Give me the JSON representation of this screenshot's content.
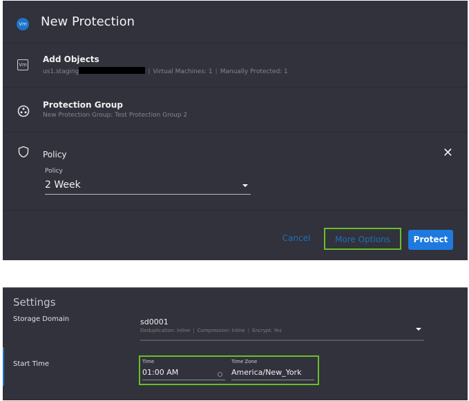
{
  "dialog": {
    "title": "New Protection",
    "title_badge": "Vm",
    "steps": [
      {
        "title": "Add Objects",
        "icon": "vm-icon",
        "icon_text": "Vm",
        "source": "us1.staging",
        "details": [
          "Virtual Machines: 1",
          "Manually Protected: 1"
        ]
      },
      {
        "title": "Protection Group",
        "icon": "protection-group-icon",
        "subtitle": "New Protection Group: Test Protection Group 2"
      },
      {
        "title": "Policy",
        "icon": "shield-icon",
        "field_label": "Policy",
        "field_value": "2 Week"
      }
    ],
    "close_icon": "close-icon",
    "buttons": {
      "cancel": "Cancel",
      "more_options": "More Options",
      "protect": "Protect"
    }
  },
  "settings": {
    "title": "Settings",
    "storage_domain": {
      "label": "Storage Domain",
      "value": "sd0001",
      "details": [
        "Deduplication: Inline",
        "Compression: Inline",
        "Encrypt: Yes"
      ]
    },
    "start_time": {
      "label": "Start Time",
      "time_label": "Time",
      "time_value": "01:00 AM",
      "timezone_label": "Time Zone",
      "timezone_value": "America/New_York"
    }
  },
  "colors": {
    "panel_bg": "#31323b",
    "accent_blue": "#1f7ae0",
    "highlight_green": "#6abf2c"
  }
}
